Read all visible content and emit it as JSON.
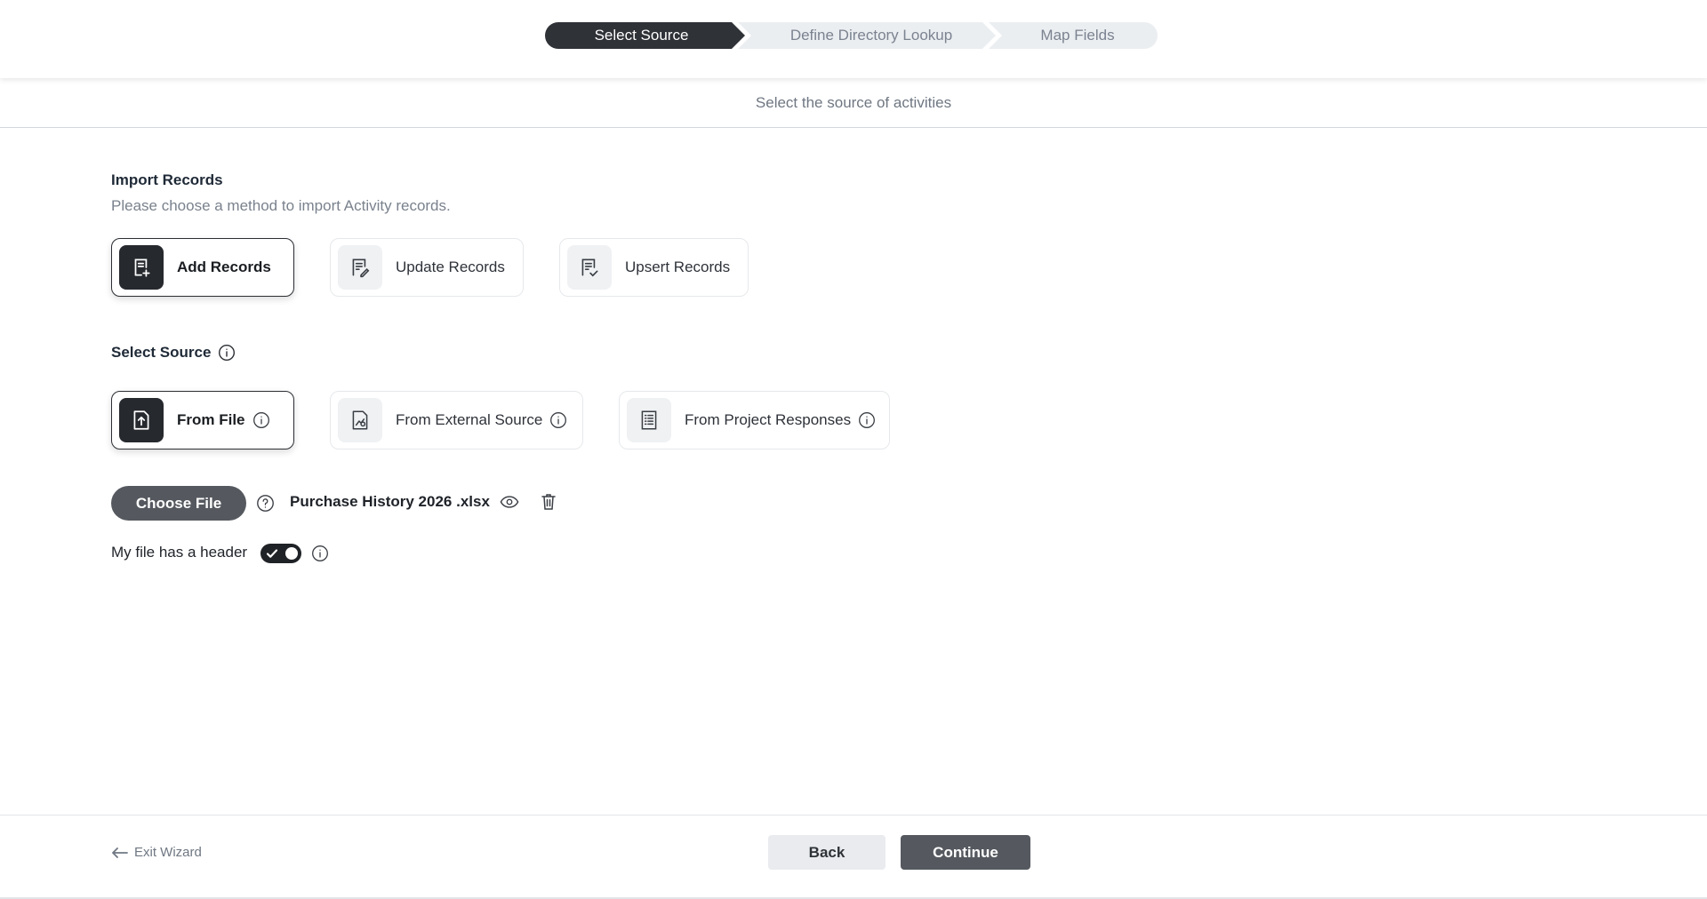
{
  "stepper": {
    "steps": [
      {
        "label": "Select Source",
        "active": true
      },
      {
        "label": "Define Directory Lookup",
        "active": false
      },
      {
        "label": "Map Fields",
        "active": false
      }
    ]
  },
  "subheader": {
    "text": "Select the source of activities"
  },
  "import_records": {
    "title": "Import Records",
    "description": "Please choose a method to import Activity records.",
    "options": [
      {
        "label": "Add Records",
        "icon": "add-document-icon",
        "selected": true
      },
      {
        "label": "Update Records",
        "icon": "edit-document-icon",
        "selected": false
      },
      {
        "label": "Upsert Records",
        "icon": "check-document-icon",
        "selected": false
      }
    ]
  },
  "select_source": {
    "title": "Select Source",
    "options": [
      {
        "label": "From File",
        "icon": "upload-file-icon",
        "selected": true
      },
      {
        "label": "From External Source",
        "icon": "external-source-icon",
        "selected": false
      },
      {
        "label": "From Project Responses",
        "icon": "project-responses-icon",
        "selected": false
      }
    ]
  },
  "file": {
    "choose_label": "Choose File",
    "file_name": "Purchase History 2026 .xlsx"
  },
  "header_toggle": {
    "label": "My file has a header",
    "on": true
  },
  "footer": {
    "exit_label": "Exit Wizard",
    "back_label": "Back",
    "continue_label": "Continue"
  },
  "colors": {
    "dark": "#2f3237",
    "button_gray": "#55595f",
    "step_inactive": "#ebeef1"
  }
}
